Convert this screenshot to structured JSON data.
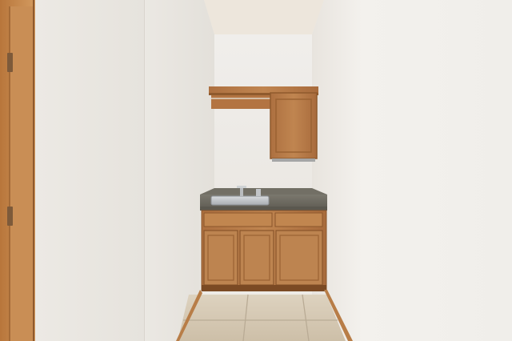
{
  "scene": {
    "subject": "laundry-utility-nook",
    "colors": {
      "wall_light": "#f2f0ec",
      "wall_left": "#eceae5",
      "wall_shadow": "#e3e0da",
      "ceiling": "#ede6dc",
      "wood": "#b77b45",
      "wood_dark": "#93592c",
      "wood_light": "#cc955e",
      "counter": "#6d6a60",
      "sink": "#c5c8cc",
      "tile": "#d7cbb7",
      "tile_grout": "#b9ab95"
    },
    "icons": {
      "faucet": "faucet-icon",
      "door_hinge": "door-hinge-icon"
    }
  }
}
